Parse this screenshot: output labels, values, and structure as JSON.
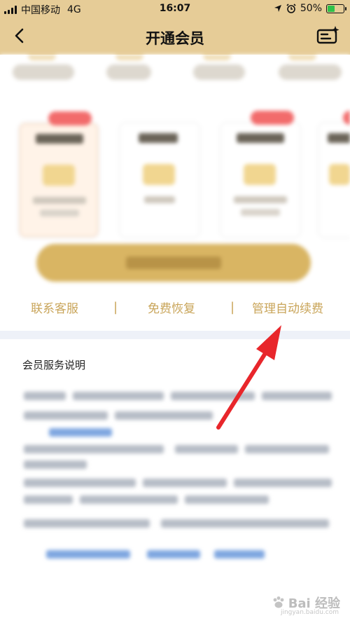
{
  "status_bar": {
    "carrier": "中国移动",
    "network": "4G",
    "time": "16:07",
    "battery_percent": "50%",
    "battery_level": 0.5
  },
  "nav": {
    "title": "开通会员",
    "back_icon": "chevron-left-icon",
    "edit_icon": "edit-sparkle-icon"
  },
  "links": {
    "contact": "联系客服",
    "restore": "免费恢复",
    "manage": "管理自动续费",
    "separator": "|"
  },
  "section": {
    "title": "会员服务说明"
  },
  "colors": {
    "header_bg": "#e6cc97",
    "link_gold": "#c9a55a",
    "arrow_red": "#e8262b"
  },
  "watermark": {
    "brand": "Bai 经验",
    "url": "jingyan.baidu.com"
  }
}
